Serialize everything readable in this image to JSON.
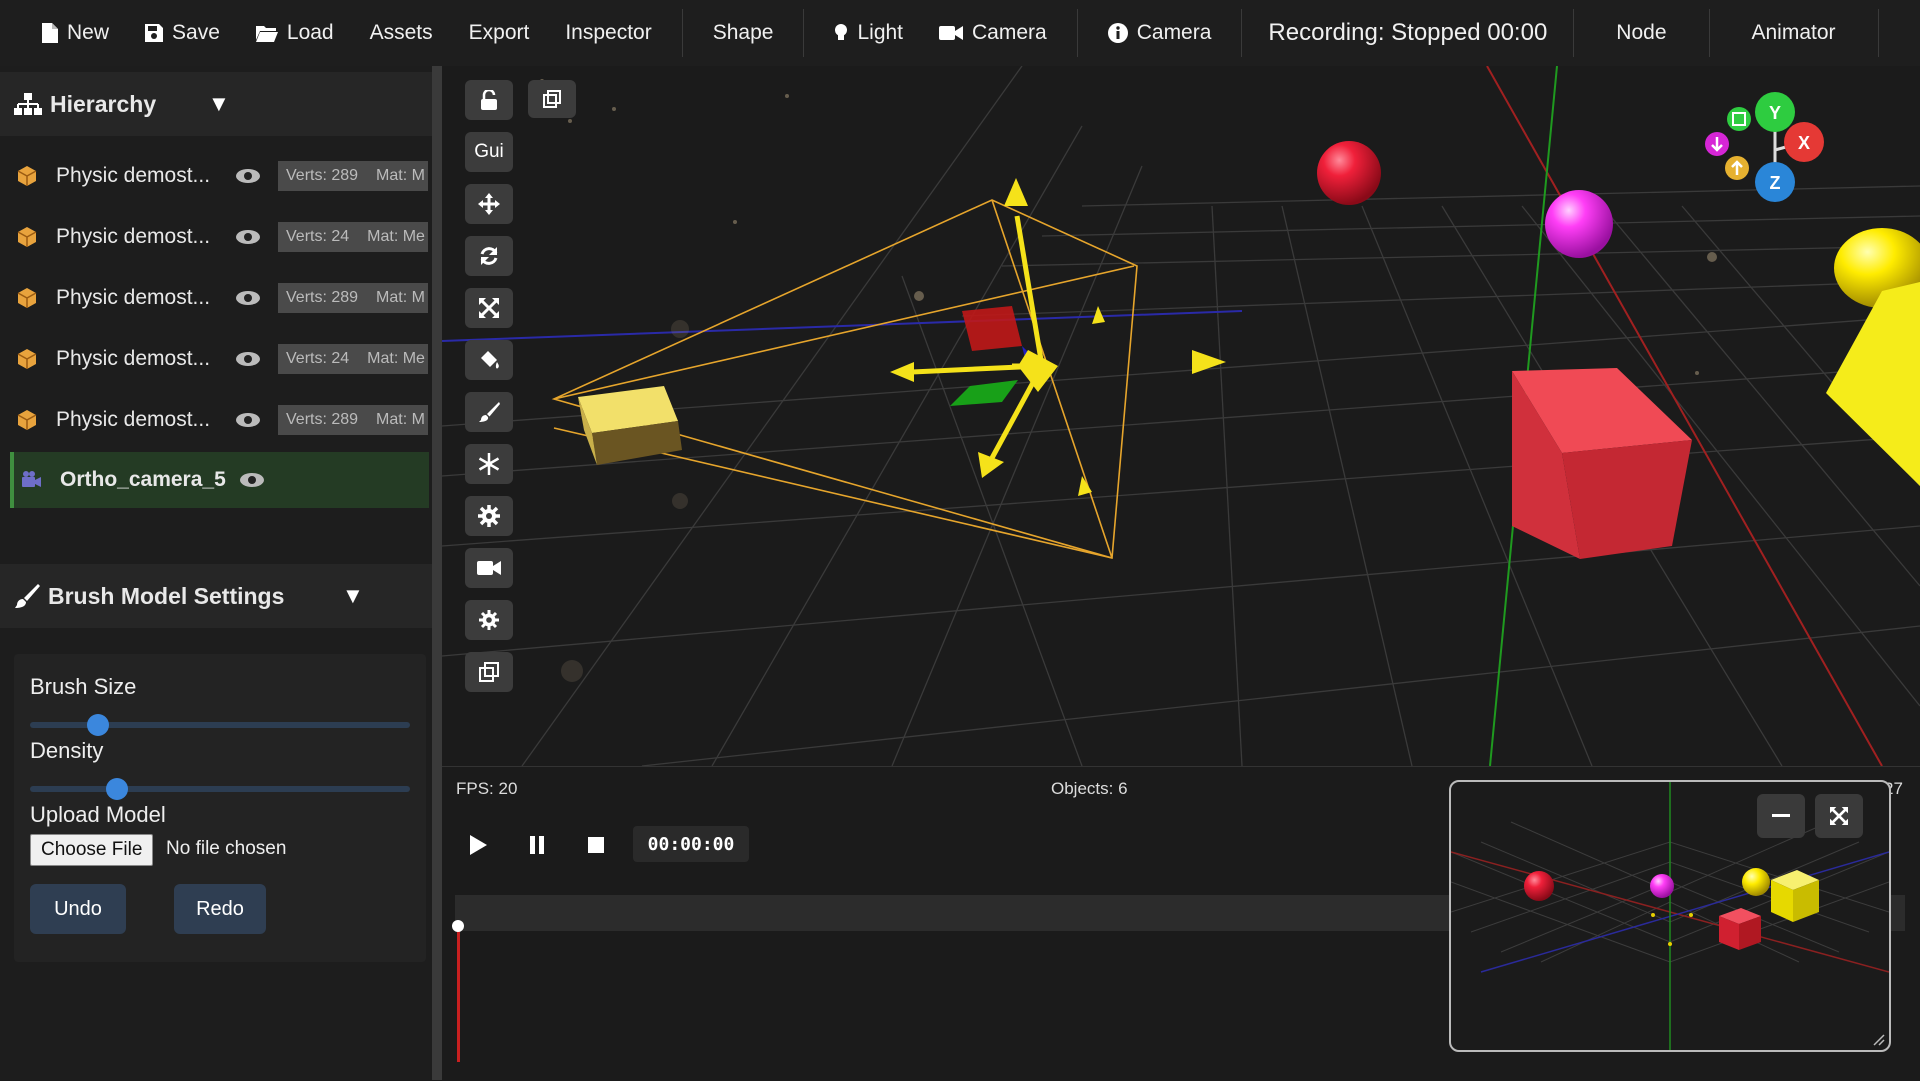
{
  "topbar": {
    "items": [
      {
        "label": "New",
        "icon": "file-icon"
      },
      {
        "label": "Save",
        "icon": "floppy-icon"
      },
      {
        "label": "Load",
        "icon": "folder-icon"
      },
      {
        "label": "Assets",
        "icon": ""
      },
      {
        "label": "Export",
        "icon": ""
      },
      {
        "label": "Inspector",
        "icon": ""
      }
    ],
    "shape": "Shape",
    "light": "Light",
    "camera": "Camera",
    "camera_info": "Camera",
    "recording": "Recording: Stopped 00:00",
    "node": "Node",
    "animator": "Animator"
  },
  "hierarchy": {
    "title": "Hierarchy",
    "items": [
      {
        "label": "Physic demost...",
        "verts": "Verts: 289",
        "mat": "Mat: M"
      },
      {
        "label": "Physic demost...",
        "verts": "Verts: 24",
        "mat": "Mat: Me"
      },
      {
        "label": "Physic demost...",
        "verts": "Verts: 289",
        "mat": "Mat: M"
      },
      {
        "label": "Physic demost...",
        "verts": "Verts: 24",
        "mat": "Mat: Me"
      },
      {
        "label": "Physic demost...",
        "verts": "Verts: 289",
        "mat": "Mat: M"
      }
    ],
    "selected": {
      "label": "Ortho_camera_5"
    }
  },
  "brush": {
    "title": "Brush Model Settings",
    "size_label": "Brush Size",
    "size_value": 0.18,
    "density_label": "Density",
    "density_value": 0.23,
    "upload_label": "Upload Model",
    "choose_file": "Choose File",
    "no_file": "No file chosen",
    "undo": "Undo",
    "redo": "Redo"
  },
  "viewport": {
    "gui_label": "Gui",
    "gizmo": {
      "y": "Y",
      "x": "X",
      "z": "Z"
    },
    "colors": {
      "x": "#e53935",
      "y": "#2ecc40",
      "z": "#2a86d8",
      "selection": "#f5d000"
    }
  },
  "timeline": {
    "fps": "FPS: 20",
    "objects": "Objects: 6",
    "right_stat": "27",
    "timecode": "00:00:00"
  }
}
